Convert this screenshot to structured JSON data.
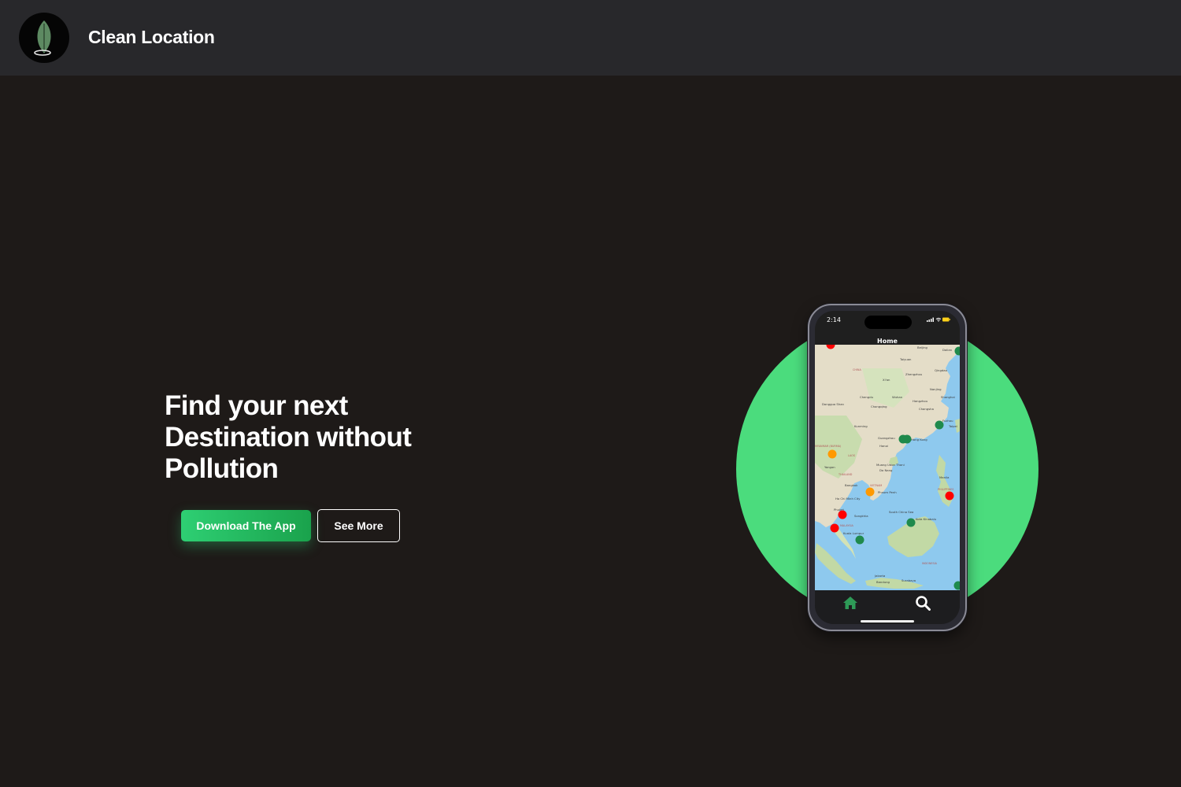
{
  "header": {
    "brand_name": "Clean Location",
    "logo_icon": "leaf-pin-icon"
  },
  "hero": {
    "title_lines": [
      "Find your next",
      "Destination without",
      "Pollution"
    ],
    "primary_button": "Download The App",
    "secondary_button": "See More"
  },
  "phone": {
    "status_time": "2:14",
    "screen_title": "Home",
    "tabs": [
      {
        "name": "home",
        "icon": "home-icon",
        "active": true
      },
      {
        "name": "search",
        "icon": "search-icon",
        "active": false
      }
    ],
    "map_labels": [
      "Beijing",
      "Dalian",
      "Taiyuan",
      "CHINA",
      "Qingdao",
      "Zhengzhou",
      "Xi'an",
      "Nanjing",
      "Chengdu",
      "Wuhan",
      "Shanghai",
      "Hangzhou",
      "Dongguo Shan",
      "Chongqing",
      "Changsha",
      "Fuzhou",
      "Taipei",
      "Kunming",
      "Guangzhou",
      "Hong Kong",
      "Hanoi",
      "MYANMAR (BURMA)",
      "LAOS",
      "Muang Udon Thani",
      "Yangon",
      "Da Nang",
      "THAILAND",
      "Manila",
      "Bangkok",
      "VIETNAM",
      "Phnom Penh",
      "PHILIPPINES",
      "Ho Chi Minh City",
      "South China Sea",
      "Phuket",
      "Songkhla",
      "Kota Kinabalu",
      "MALAYSIA",
      "Kuala Lumpur",
      "INDONESIA",
      "Jakarta",
      "Bandung",
      "Surabaya"
    ]
  },
  "colors": {
    "background": "#1e1a18",
    "header": "#28282b",
    "accent_green": "#4bdc7d",
    "button_green": "#2ecf73",
    "marker_red": "#ff0000",
    "marker_orange": "#ff9900",
    "marker_green": "#1f8a4c"
  }
}
